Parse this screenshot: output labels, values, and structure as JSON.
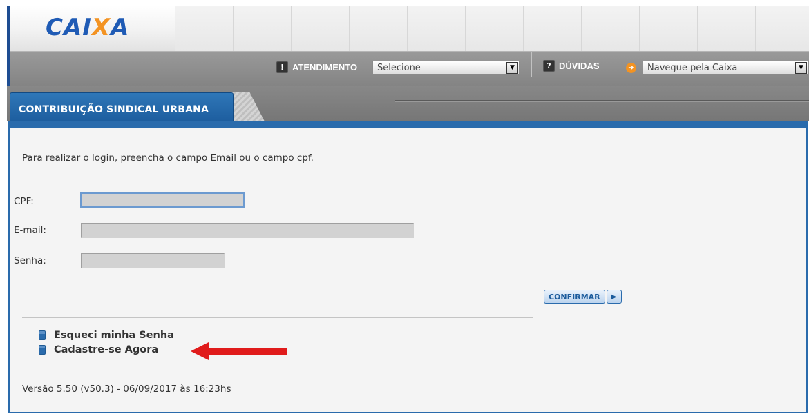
{
  "header": {
    "logo": {
      "text": "CAIXA",
      "brand_color": "#1f5bb5",
      "accent_color": "#f39322"
    },
    "header_cell_count": 11
  },
  "nav": {
    "atendimento": {
      "badge": "!",
      "label": "ATENDIMENTO",
      "select_value": "Selecione"
    },
    "duvidas": {
      "badge": "?",
      "label": "DÚVIDAS"
    },
    "navegue": {
      "arrow_icon": "arrow-right-icon",
      "select_value": "Navegue pela Caixa"
    }
  },
  "tab": {
    "title": "CONTRIBUIÇÃO SINDICAL URBANA",
    "color": "#2a6bac"
  },
  "form": {
    "instruction": "Para realizar o login, preencha o campo Email ou o campo cpf.",
    "cpf_label": "CPF:",
    "email_label": "E-mail:",
    "senha_label": "Senha:",
    "cpf_value": "",
    "email_value": "",
    "senha_value": "",
    "confirm_label": "CONFIRMAR"
  },
  "links": {
    "forgot": "Esqueci minha Senha",
    "register": "Cadastre-se Agora"
  },
  "annotation": {
    "arrow_color": "#e01b1b"
  },
  "footer": {
    "version": "Versão 5.50 (v50.3) - 06/09/2017 às 16:23hs"
  }
}
